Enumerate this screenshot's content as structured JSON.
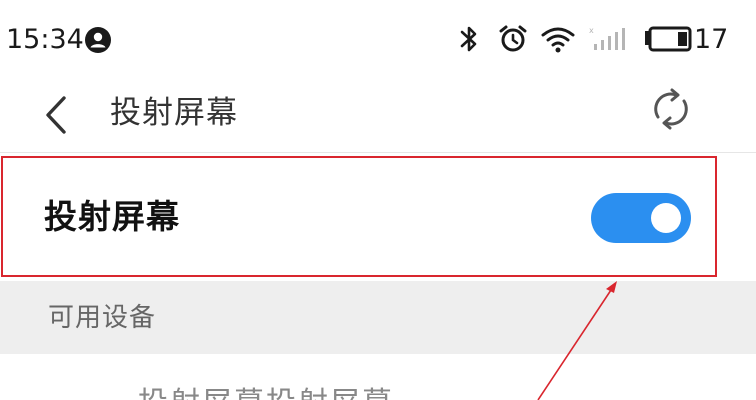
{
  "status_bar": {
    "time": "15:34",
    "battery_level": "17",
    "icons": [
      "user-circle-icon",
      "bluetooth-icon",
      "alarm-clock-icon",
      "wifi-icon",
      "signal-icon",
      "battery-icon"
    ]
  },
  "title_bar": {
    "title": "投射屏幕",
    "icons": [
      "back-arrow-icon",
      "refresh-icon"
    ]
  },
  "toggle_row": {
    "label": "投射屏幕",
    "state": "on",
    "colors": {
      "switch_on": "#2b8ff0",
      "knob": "#ffffff"
    }
  },
  "section": {
    "label": "可用设备"
  },
  "device_list": {
    "partial_item_text": "投射屏幕投射屏幕"
  },
  "annotation": {
    "highlight_color": "#d9262e",
    "arrow_color": "#d9262e"
  }
}
